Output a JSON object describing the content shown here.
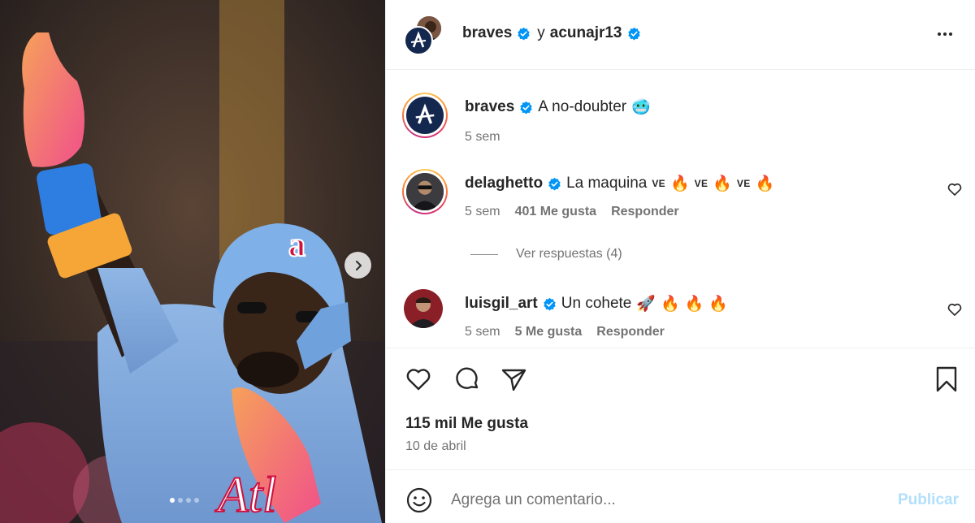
{
  "post": {
    "authors": {
      "primary": "braves",
      "joiner": "y",
      "secondary": "acunajr13"
    },
    "caption": {
      "username": "braves",
      "text": "A no-doubter",
      "emoji": "🥶",
      "age": "5 sem"
    },
    "likes_label": "115 mil Me gusta",
    "date_label": "10 de abril",
    "carousel": {
      "total_slides": 4,
      "current_slide": 1
    }
  },
  "comments": [
    {
      "username": "delaghetto",
      "text": "La maquina",
      "tail": [
        "VE",
        "🔥",
        "VE",
        "🔥",
        "VE",
        "🔥"
      ],
      "age": "5 sem",
      "likes": "401 Me gusta",
      "reply_label": "Responder",
      "view_replies": "Ver respuestas (4)"
    },
    {
      "username": "luisgil_art",
      "text": "Un cohete",
      "tail": [
        "🚀",
        "🔥",
        "🔥",
        "🔥"
      ],
      "age": "5 sem",
      "likes": "5 Me gusta",
      "reply_label": "Responder"
    }
  ],
  "composer": {
    "placeholder": "Agrega un comentario...",
    "publish_label": "Publicar"
  },
  "colors": {
    "verified": "#0095f6",
    "publish_disabled": "#b2dffc",
    "braves_navy": "#13274f",
    "braves_red": "#ce1141"
  },
  "icons": [
    "chevron-right-icon",
    "more-options-icon",
    "verified-icon",
    "heart-icon",
    "comment-icon",
    "share-icon",
    "bookmark-icon",
    "emoji-icon"
  ]
}
